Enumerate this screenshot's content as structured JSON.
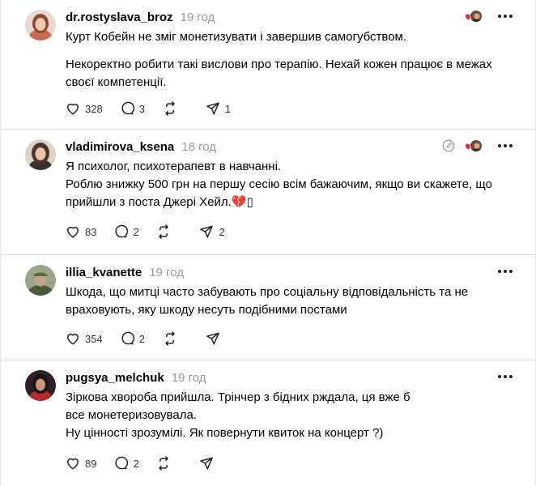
{
  "posts": [
    {
      "username": "dr.rostyslava_broz",
      "time": "19 год",
      "text": [
        "Курт Кобейн не зміг монетизувати і завершив самогубством.",
        "",
        "Некоректно робити такі вислови про терапію. Нехай кожен працює в межах\nсвоєї компетенції."
      ],
      "likes": "328",
      "replies": "3",
      "reposts": "",
      "shares": "1"
    },
    {
      "username": "vladimirova_ksena",
      "time": "18 год",
      "text": [
        "Я психолог, психотерапевт в навчанні.",
        "Роблю знижку 500 грн на першу сесію всім бажаючим, якщо ви скажете, що\nприйшли з поста Джері Хейл.💔▯"
      ],
      "likes": "83",
      "replies": "2",
      "reposts": "",
      "shares": "2"
    },
    {
      "username": "illia_kvanette",
      "time": "19 год",
      "text": [
        "Шкода, що митці часто забувають про соціальну відповідальність та не\nвраховують, яку шкоду несуть подібними постами"
      ],
      "likes": "354",
      "replies": "2",
      "reposts": "",
      "shares": ""
    },
    {
      "username": "pugsya_melchuk",
      "time": "19 год",
      "text": [
        "Зіркова хвороба прийшла. Трінчер з бідних рждала, ця вже б\nвсе монетеризовувала.",
        "Ну цінності зрозумілі. Як повернути квиток на концерт ?)"
      ],
      "likes": "89",
      "replies": "2",
      "reposts": "",
      "shares": ""
    }
  ],
  "icons": {
    "like": "heart-icon",
    "reply": "reply-icon",
    "repost": "repost-icon",
    "share": "share-icon",
    "more": "more-icon",
    "edit": "edit-icon"
  },
  "colors": {
    "liked_heart": "#e0243b",
    "muted_text": "#999999",
    "divider": "#dcdcdc"
  }
}
